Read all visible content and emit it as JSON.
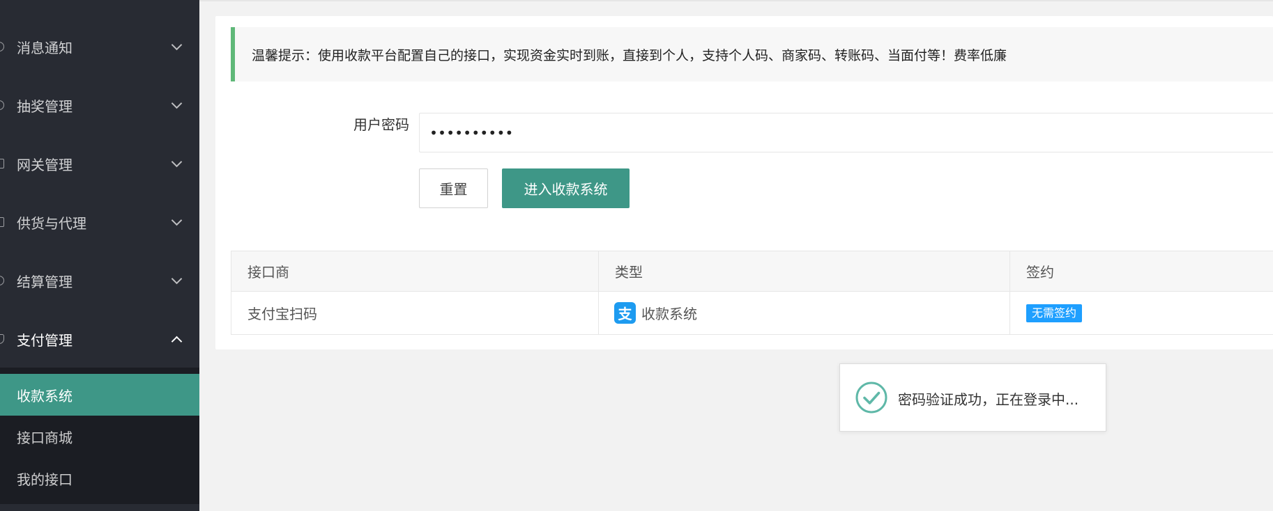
{
  "sidebar": {
    "groups": [
      {
        "label": "消息通知",
        "icon": "bell-icon",
        "open": false
      },
      {
        "label": "抽奖管理",
        "icon": "gift-icon",
        "open": false
      },
      {
        "label": "网关管理",
        "icon": "gateway-icon",
        "open": false
      },
      {
        "label": "供货与代理",
        "icon": "supply-icon",
        "open": false
      },
      {
        "label": "结算管理",
        "icon": "settlement-icon",
        "open": false
      },
      {
        "label": "支付管理",
        "icon": "shield-icon",
        "open": true
      }
    ],
    "submenu": [
      {
        "label": "收款系统",
        "active": true
      },
      {
        "label": "接口商城",
        "active": false
      },
      {
        "label": "我的接口",
        "active": false
      }
    ]
  },
  "main": {
    "tip": "温馨提示：使用收款平台配置自己的接口，实现资金实时到账，直接到个人，支持个人码、商家码、转账码、当面付等！费率低廉",
    "form": {
      "password_label": "用户密码",
      "password_value": "••••••••••"
    },
    "buttons": {
      "reset": "重置",
      "enter": "进入收款系统"
    },
    "table": {
      "headers": [
        "接口商",
        "类型",
        "签约"
      ],
      "rows": [
        {
          "provider": "支付宝扫码",
          "type_icon": "alipay-icon",
          "type_logo_char": "支",
          "type": "收款系统",
          "sign": "无需签约"
        }
      ]
    }
  },
  "toast": {
    "icon": "check-circle-icon",
    "text": "密码验证成功，正在登录中..."
  },
  "colors": {
    "sidebar_bg": "#282b33",
    "submenu_bg": "#1b1d23",
    "accent": "#3e9787",
    "tip_border": "#5fb878",
    "badge": "#1e9fff",
    "alipay": "#1d9bf0"
  }
}
